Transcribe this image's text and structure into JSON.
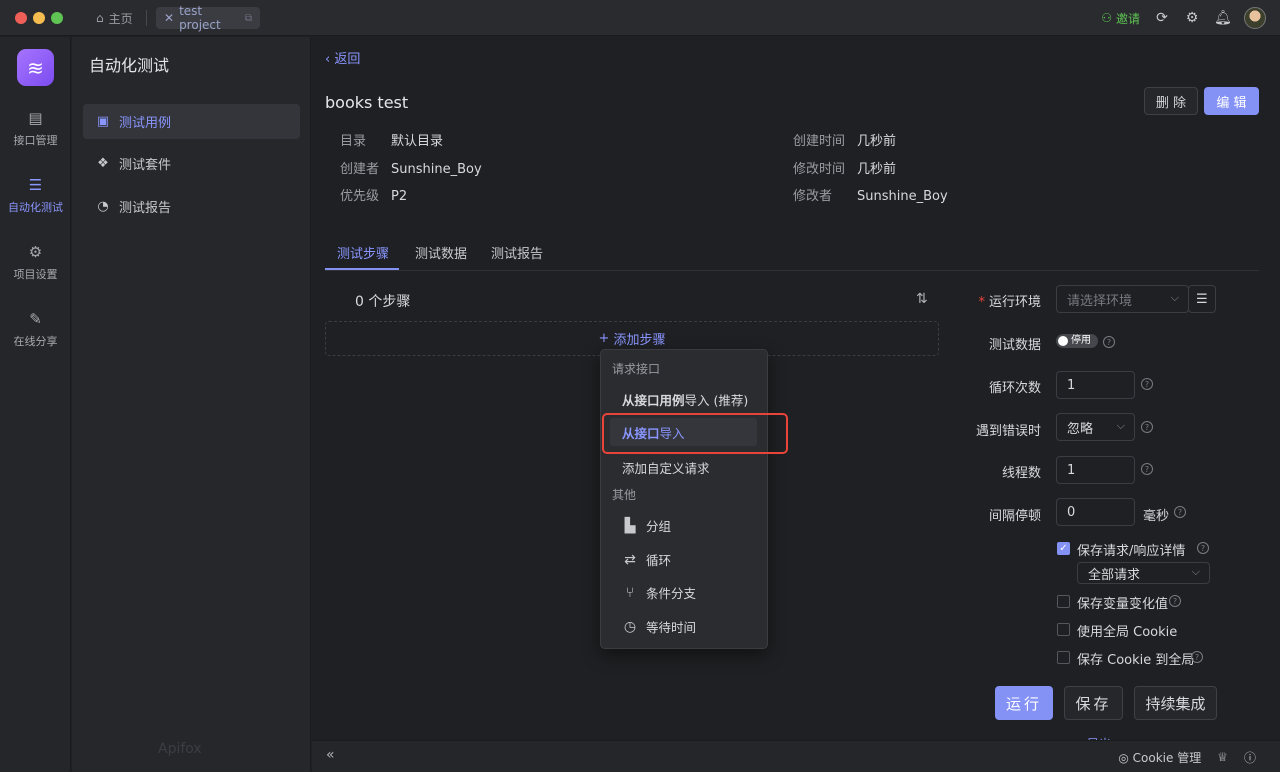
{
  "titlebar": {
    "home_tab": "主页",
    "project_tab": "test project",
    "invite": "邀请"
  },
  "rail": {
    "items": [
      {
        "label": "接口管理",
        "icon": "api-icon"
      },
      {
        "label": "自动化测试",
        "icon": "automation-icon"
      },
      {
        "label": "项目设置",
        "icon": "project-settings-icon"
      },
      {
        "label": "在线分享",
        "icon": "share-icon"
      }
    ],
    "brand": "Apifox"
  },
  "sidebar": {
    "title": "自动化测试",
    "items": [
      {
        "label": "测试用例"
      },
      {
        "label": "测试套件"
      },
      {
        "label": "测试报告"
      }
    ]
  },
  "main": {
    "back": "返回",
    "title": "books test",
    "delete_label": "删 除",
    "edit_label": "编 辑",
    "meta": {
      "dir_k": "目录",
      "dir_v": "默认目录",
      "creator_k": "创建者",
      "creator_v": "Sunshine_Boy",
      "priority_k": "优先级",
      "priority_v": "P2",
      "created_k": "创建时间",
      "created_v": "几秒前",
      "modified_k": "修改时间",
      "modified_v": "几秒前",
      "modifier_k": "修改者",
      "modifier_v": "Sunshine_Boy"
    },
    "tabs": [
      "测试步骤",
      "测试数据",
      "测试报告"
    ],
    "steps_count": "0 个步骤",
    "add_step": "添加步骤"
  },
  "dropdown": {
    "group1": "请求接口",
    "item1_bold": "从接口用例",
    "item1_rest": "导入 (推荐)",
    "item2_bold": "从接口",
    "item2_rest": "导入",
    "item3": "添加自定义请求",
    "group2": "其他",
    "item4": "分组",
    "item5": "循环",
    "item6": "条件分支",
    "item7": "等待时间"
  },
  "form": {
    "env_label": "运行环境",
    "env_placeholder": "请选择环境",
    "data_label": "测试数据",
    "data_toggle": "停用",
    "loop_label": "循环次数",
    "loop_value": "1",
    "error_label": "遇到错误时",
    "error_value": "忽略",
    "threads_label": "线程数",
    "threads_value": "1",
    "interval_label": "间隔停顿",
    "interval_value": "0",
    "interval_unit": "毫秒",
    "save_detail_label": "保存请求/响应详情",
    "save_detail_value": "全部请求",
    "save_var_label": "保存变量变化值",
    "global_cookie_label": "使用全局 Cookie",
    "save_cookie_label": "保存 Cookie 到全局",
    "run": "运行",
    "save": "保存",
    "ci": "持续集成",
    "export_peek": "导出"
  },
  "bottombar": {
    "cookie": "Cookie 管理"
  },
  "colors": {
    "accent": "#8491f5",
    "highlight_box": "#e9443a",
    "invite": "#5fc453"
  }
}
